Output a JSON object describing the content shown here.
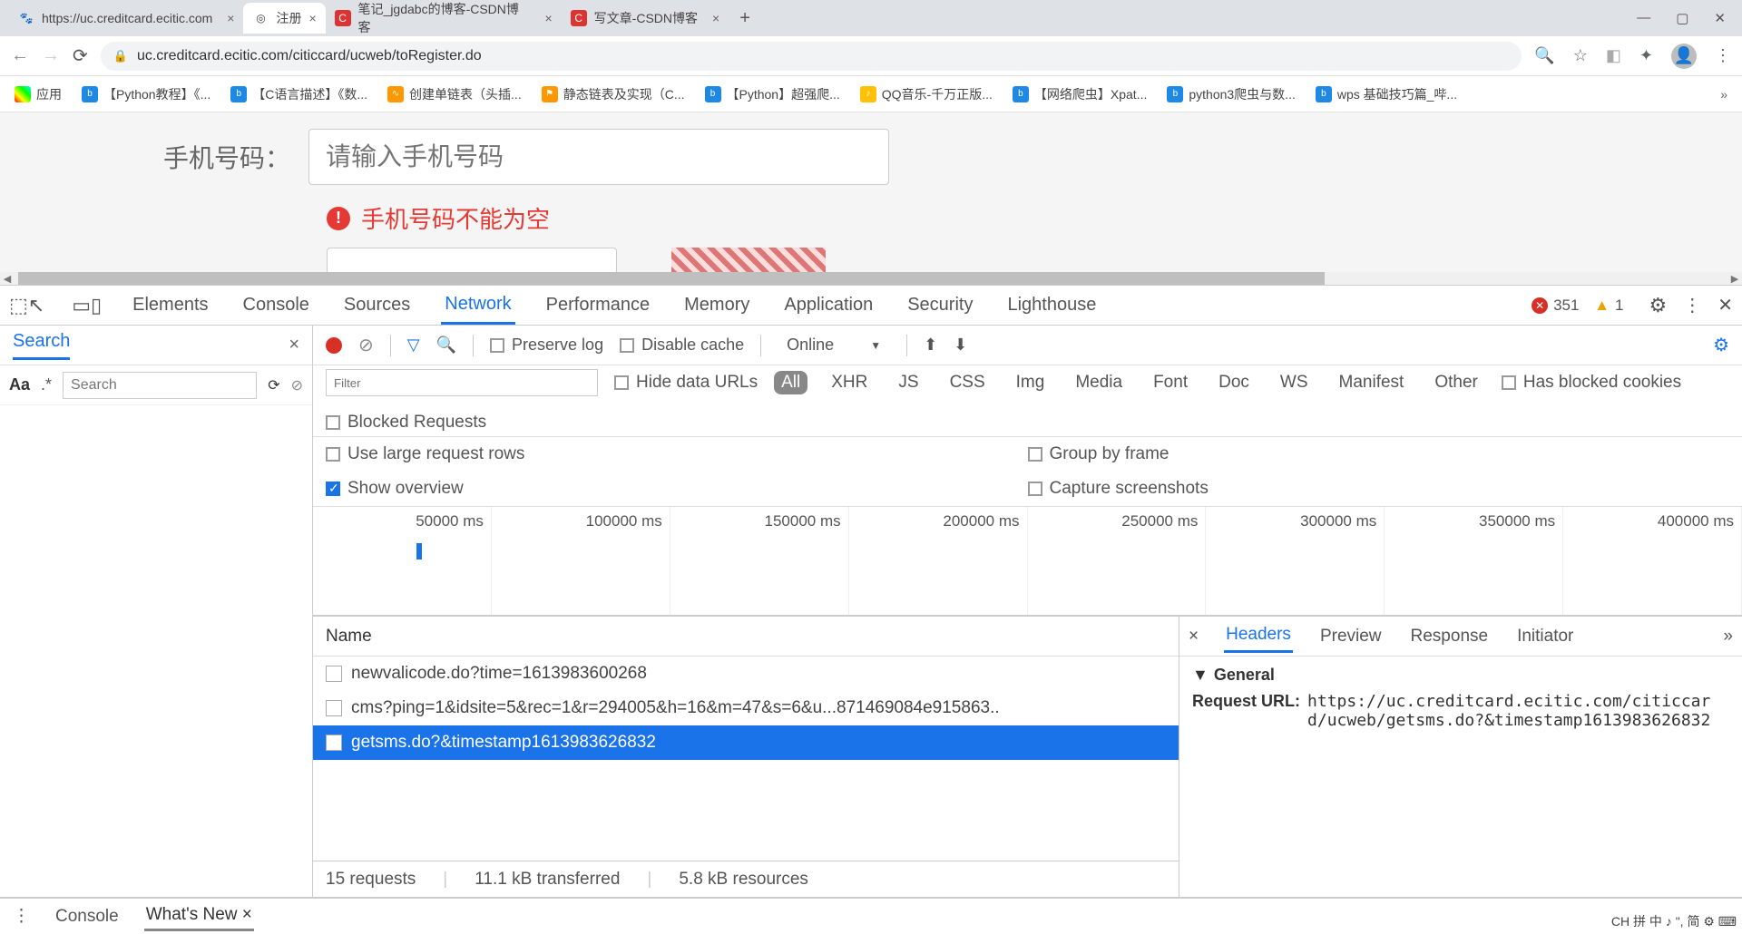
{
  "browser": {
    "tabs": [
      {
        "title": "https://uc.creditcard.ecitic.com",
        "active": false,
        "fav": "🐾"
      },
      {
        "title": "注册",
        "active": true,
        "fav": "◎"
      },
      {
        "title": "笔记_jgdabc的博客-CSDN博客",
        "active": false,
        "fav": "C"
      },
      {
        "title": "写文章-CSDN博客",
        "active": false,
        "fav": "C"
      }
    ],
    "url": "uc.creditcard.ecitic.com/citiccard/ucweb/toRegister.do",
    "apps_label": "应用"
  },
  "bookmarks": [
    "【Python教程】《...",
    "【C语言描述】《数...",
    "创建单链表（头插...",
    "静态链表及实现（C...",
    "【Python】超强爬...",
    "QQ音乐-千万正版...",
    "【网络爬虫】Xpat...",
    "python3爬虫与数...",
    "wps 基础技巧篇_哔..."
  ],
  "page": {
    "phone_label": "手机号码：",
    "phone_placeholder": "请输入手机号码",
    "error_text": "手机号码不能为空"
  },
  "devtools": {
    "tabs": [
      "Elements",
      "Console",
      "Sources",
      "Network",
      "Performance",
      "Memory",
      "Application",
      "Security",
      "Lighthouse"
    ],
    "active_tab": "Network",
    "errors": "351",
    "warnings": "1",
    "search_title": "Search",
    "search_placeholder": "Search",
    "toolbar": {
      "preserve_log": "Preserve log",
      "disable_cache": "Disable cache",
      "throttle": "Online"
    },
    "filter_placeholder": "Filter",
    "hide_data_urls": "Hide data URLs",
    "filter_chips": [
      "All",
      "XHR",
      "JS",
      "CSS",
      "Img",
      "Media",
      "Font",
      "Doc",
      "WS",
      "Manifest",
      "Other"
    ],
    "blocked_cookies": "Has blocked cookies",
    "blocked_requests": "Blocked Requests",
    "options": {
      "large_rows": "Use large request rows",
      "show_overview": "Show overview",
      "group_frame": "Group by frame",
      "screenshots": "Capture screenshots"
    },
    "timeline": [
      "50000 ms",
      "100000 ms",
      "150000 ms",
      "200000 ms",
      "250000 ms",
      "300000 ms",
      "350000 ms",
      "400000 ms"
    ],
    "name_header": "Name",
    "requests": [
      "newvalicode.do?time=1613983600268",
      "cms?ping=1&idsite=5&rec=1&r=294005&h=16&m=47&s=6&u...871469084e915863..",
      "getsms.do?&timestamp1613983626832"
    ],
    "selected_request_index": 2,
    "status": {
      "count": "15 requests",
      "transferred": "11.1 kB transferred",
      "resources": "5.8 kB resources"
    },
    "detail_tabs": [
      "Headers",
      "Preview",
      "Response",
      "Initiator"
    ],
    "general_title": "General",
    "general": {
      "url_label": "Request URL:",
      "url_value": "https://uc.creditcard.ecitic.com/citiccard/ucweb/getsms.do?&timestamp1613983626832"
    },
    "drawer_tabs": [
      "Console",
      "What's New"
    ]
  },
  "ime": "CH 拼 中 ♪ \", 简 ⚙ ⌨"
}
